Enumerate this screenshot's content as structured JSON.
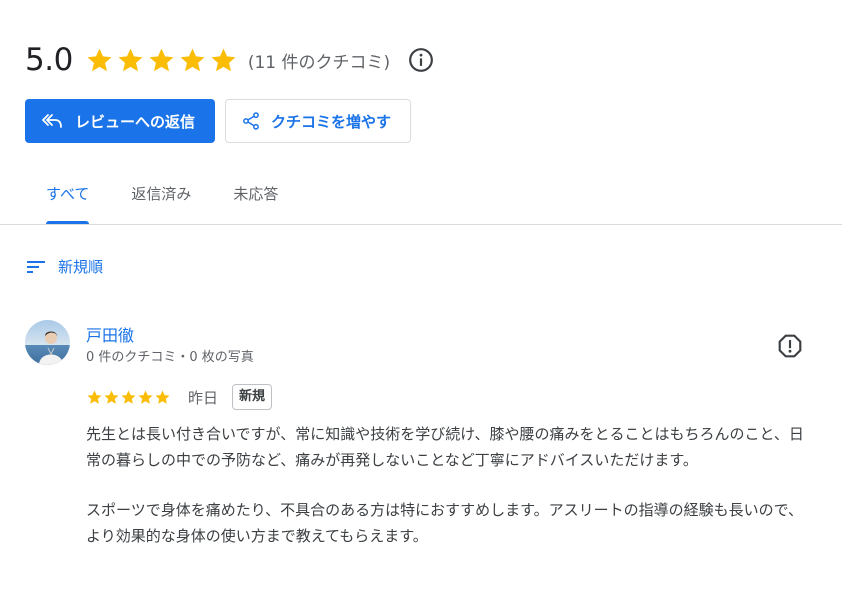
{
  "rating": {
    "score": "5.0",
    "stars": 5,
    "count_text": "(11 件のクチコミ)",
    "star_color": "#fbbc04"
  },
  "actions": {
    "reply_label": "レビューへの返信",
    "grow_label": "クチコミを増やす"
  },
  "tabs": [
    {
      "label": "すべて",
      "active": true
    },
    {
      "label": "返信済み",
      "active": false
    },
    {
      "label": "未応答",
      "active": false
    }
  ],
  "sort": {
    "label": "新規順"
  },
  "review": {
    "author": "戸田徹",
    "meta": "0 件のクチコミ・0 枚の写真",
    "stars": 5,
    "date": "昨日",
    "badge": "新規",
    "paragraphs": [
      "先生とは長い付き合いですが、常に知識や技術を学び続け、膝や腰の痛みをとることはもちろんのこと、日常の暮らしの中での予防など、痛みが再発しないことなど丁寧にアドバイスいただけます。",
      "スポーツで身体を痛めたり、不具合のある方は特におすすめします。アスリートの指導の経験も長いので、より効果的な身体の使い方まで教えてもらえます。"
    ]
  },
  "icons": {
    "info": "info-icon",
    "reply": "reply-all-icon",
    "share": "share-icon",
    "sort": "sort-lines-icon",
    "flag": "report-icon"
  },
  "colors": {
    "accent": "#1a73e8",
    "text": "#202124",
    "secondary_text": "#5f6368"
  }
}
